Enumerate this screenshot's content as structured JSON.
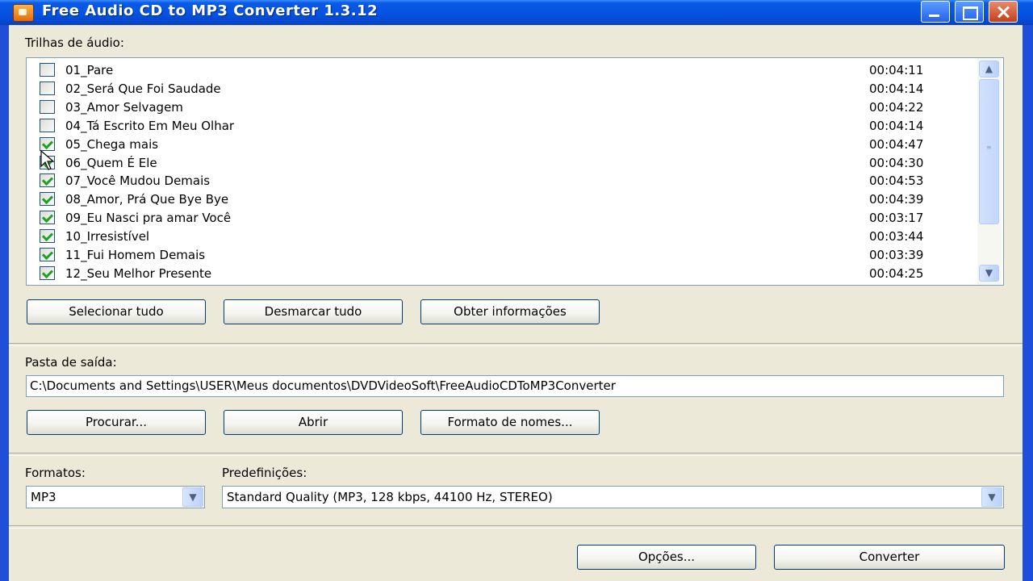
{
  "window": {
    "title": "Free Audio CD to MP3 Converter 1.3.12"
  },
  "tracks_section": {
    "label": "Trilhas de áudio:",
    "tracks": [
      {
        "name": "01_Pare",
        "duration": "00:04:11",
        "checked": false
      },
      {
        "name": "02_Será Que Foi Saudade",
        "duration": "00:04:14",
        "checked": false
      },
      {
        "name": "03_Amor Selvagem",
        "duration": "00:04:22",
        "checked": false
      },
      {
        "name": "04_Tá Escrito Em Meu Olhar",
        "duration": "00:04:14",
        "checked": false
      },
      {
        "name": "05_Chega mais",
        "duration": "00:04:47",
        "checked": true
      },
      {
        "name": "06_Quem É Ele",
        "duration": "00:04:30",
        "checked": true
      },
      {
        "name": "07_Você Mudou Demais",
        "duration": "00:04:53",
        "checked": true
      },
      {
        "name": "08_Amor, Prá Que Bye Bye",
        "duration": "00:04:39",
        "checked": true
      },
      {
        "name": "09_Eu Nasci pra amar Você",
        "duration": "00:03:17",
        "checked": true
      },
      {
        "name": "10_Irresistível",
        "duration": "00:03:44",
        "checked": true
      },
      {
        "name": "11_Fui Homem Demais",
        "duration": "00:03:39",
        "checked": true
      },
      {
        "name": "12_Seu Melhor Presente",
        "duration": "00:04:25",
        "checked": true
      }
    ],
    "buttons": {
      "select_all": "Selecionar tudo",
      "deselect_all": "Desmarcar tudo",
      "get_info": "Obter informações"
    }
  },
  "output_section": {
    "label": "Pasta de saída:",
    "path": "C:\\Documents and Settings\\USER\\Meus documentos\\DVDVideoSoft\\FreeAudioCDToMP3Converter",
    "buttons": {
      "browse": "Procurar...",
      "open": "Abrir",
      "name_format": "Formato de nomes..."
    }
  },
  "format_section": {
    "formats_label": "Formatos:",
    "format_value": "MP3",
    "presets_label": "Predefinições:",
    "preset_value": "Standard Quality (MP3, 128 kbps, 44100 Hz, STEREO)"
  },
  "footer": {
    "options": "Opções...",
    "convert": "Converter"
  },
  "colors": {
    "titlebar": "#0554e3",
    "dialog_bg": "#ece9d8",
    "check_green": "#21a121",
    "close_button": "#c4401c"
  },
  "icons": {
    "app": "cd-converter-icon",
    "minimize": "minimize-icon",
    "maximize": "maximize-icon",
    "close": "close-icon"
  }
}
